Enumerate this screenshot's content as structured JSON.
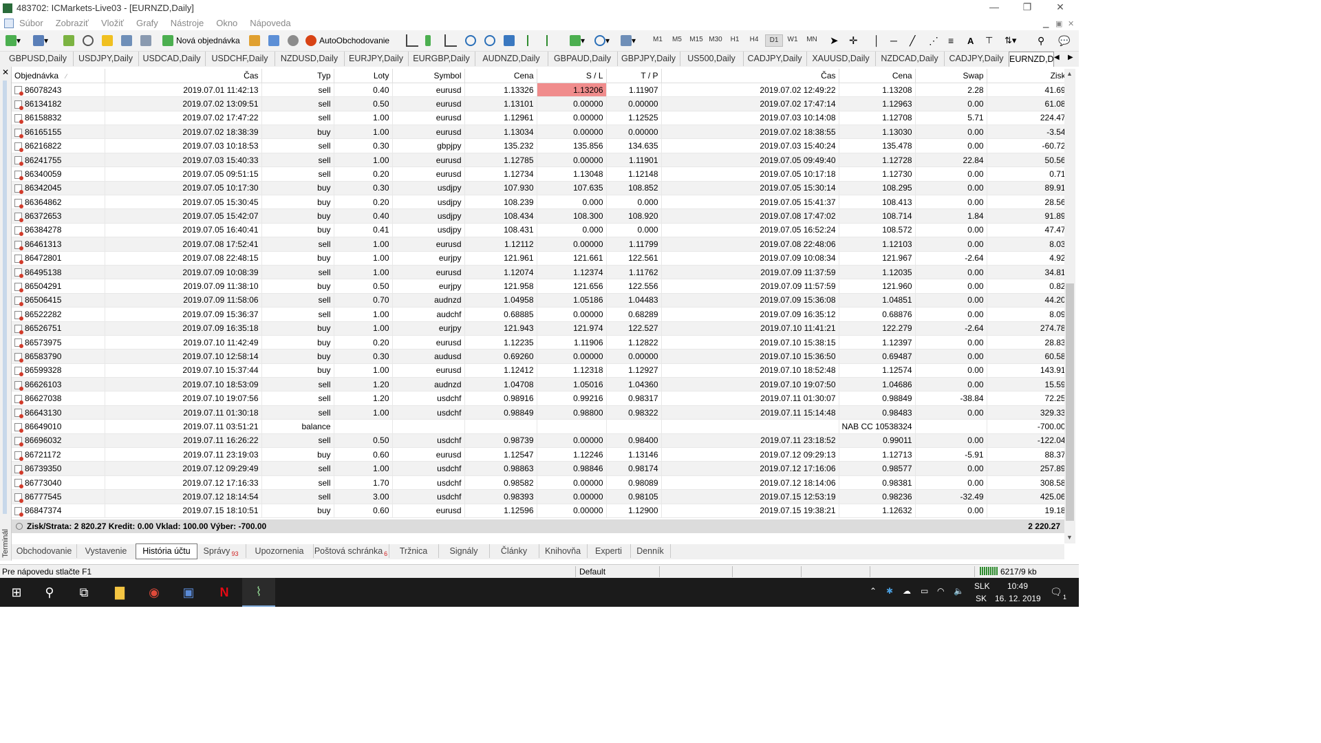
{
  "window": {
    "title": "483702: ICMarkets-Live03 - [EURNZD,Daily]",
    "min": "—",
    "max": "❐",
    "close": "✕"
  },
  "menu": {
    "items": [
      "Súbor",
      "Zobraziť",
      "Vložiť",
      "Grafy",
      "Nástroje",
      "Okno",
      "Nápoveda"
    ]
  },
  "toolbar": {
    "new_order": "Nová objednávka",
    "autotrading": "AutoObchodovanie",
    "timeframes": [
      "M1",
      "M5",
      "M15",
      "M30",
      "H1",
      "H4",
      "D1",
      "W1",
      "MN"
    ],
    "active_timeframe": "D1"
  },
  "chart_tabs": [
    "GBPUSD,Daily",
    "USDJPY,Daily",
    "USDCAD,Daily",
    "USDCHF,Daily",
    "NZDUSD,Daily",
    "EURJPY,Daily",
    "EURGBP,Daily",
    "AUDNZD,Daily",
    "GBPAUD,Daily",
    "GBPJPY,Daily",
    "US500,Daily",
    "CADJPY,Daily",
    "XAUUSD,Daily",
    "NZDCAD,Daily",
    "CADJPY,Daily",
    "EURNZD,Daily"
  ],
  "columns": [
    "Objednávka",
    "Čas",
    "Typ",
    "Loty",
    "Symbol",
    "Cena",
    "S / L",
    "T / P",
    "Čas",
    "Cena",
    "Swap",
    "Zisk"
  ],
  "rows": [
    [
      "86078243",
      "2019.07.01 11:42:13",
      "sell",
      "0.40",
      "eurusd",
      "1.13326",
      "1.13206",
      "1.11907",
      "2019.07.02 12:49:22",
      "1.13208",
      "2.28",
      "41.69"
    ],
    [
      "86134182",
      "2019.07.02 13:09:51",
      "sell",
      "0.50",
      "eurusd",
      "1.13101",
      "0.00000",
      "0.00000",
      "2019.07.02 17:47:14",
      "1.12963",
      "0.00",
      "61.08"
    ],
    [
      "86158832",
      "2019.07.02 17:47:22",
      "sell",
      "1.00",
      "eurusd",
      "1.12961",
      "0.00000",
      "1.12525",
      "2019.07.03 10:14:08",
      "1.12708",
      "5.71",
      "224.47"
    ],
    [
      "86165155",
      "2019.07.02 18:38:39",
      "buy",
      "1.00",
      "eurusd",
      "1.13034",
      "0.00000",
      "0.00000",
      "2019.07.02 18:38:55",
      "1.13030",
      "0.00",
      "-3.54"
    ],
    [
      "86216822",
      "2019.07.03 10:18:53",
      "sell",
      "0.30",
      "gbpjpy",
      "135.232",
      "135.856",
      "134.635",
      "2019.07.03 15:40:24",
      "135.478",
      "0.00",
      "-60.72"
    ],
    [
      "86241755",
      "2019.07.03 15:40:33",
      "sell",
      "1.00",
      "eurusd",
      "1.12785",
      "0.00000",
      "1.11901",
      "2019.07.05 09:49:40",
      "1.12728",
      "22.84",
      "50.56"
    ],
    [
      "86340059",
      "2019.07.05 09:51:15",
      "sell",
      "0.20",
      "eurusd",
      "1.12734",
      "1.13048",
      "1.12148",
      "2019.07.05 10:17:18",
      "1.12730",
      "0.00",
      "0.71"
    ],
    [
      "86342045",
      "2019.07.05 10:17:30",
      "buy",
      "0.30",
      "usdjpy",
      "107.930",
      "107.635",
      "108.852",
      "2019.07.05 15:30:14",
      "108.295",
      "0.00",
      "89.91"
    ],
    [
      "86364862",
      "2019.07.05 15:30:45",
      "buy",
      "0.20",
      "usdjpy",
      "108.239",
      "0.000",
      "0.000",
      "2019.07.05 15:41:37",
      "108.413",
      "0.00",
      "28.56"
    ],
    [
      "86372653",
      "2019.07.05 15:42:07",
      "buy",
      "0.40",
      "usdjpy",
      "108.434",
      "108.300",
      "108.920",
      "2019.07.08 17:47:02",
      "108.714",
      "1.84",
      "91.89"
    ],
    [
      "86384278",
      "2019.07.05 16:40:41",
      "buy",
      "0.41",
      "usdjpy",
      "108.431",
      "0.000",
      "0.000",
      "2019.07.05 16:52:24",
      "108.572",
      "0.00",
      "47.47"
    ],
    [
      "86461313",
      "2019.07.08 17:52:41",
      "sell",
      "1.00",
      "eurusd",
      "1.12112",
      "0.00000",
      "1.11799",
      "2019.07.08 22:48:06",
      "1.12103",
      "0.00",
      "8.03"
    ],
    [
      "86472801",
      "2019.07.08 22:48:15",
      "buy",
      "1.00",
      "eurjpy",
      "121.961",
      "121.661",
      "122.561",
      "2019.07.09 10:08:34",
      "121.967",
      "-2.64",
      "4.92"
    ],
    [
      "86495138",
      "2019.07.09 10:08:39",
      "sell",
      "1.00",
      "eurusd",
      "1.12074",
      "1.12374",
      "1.11762",
      "2019.07.09 11:37:59",
      "1.12035",
      "0.00",
      "34.81"
    ],
    [
      "86504291",
      "2019.07.09 11:38:10",
      "buy",
      "0.50",
      "eurjpy",
      "121.958",
      "121.656",
      "122.556",
      "2019.07.09 11:57:59",
      "121.960",
      "0.00",
      "0.82"
    ],
    [
      "86506415",
      "2019.07.09 11:58:06",
      "sell",
      "0.70",
      "audnzd",
      "1.04958",
      "1.05186",
      "1.04483",
      "2019.07.09 15:36:08",
      "1.04851",
      "0.00",
      "44.20"
    ],
    [
      "86522282",
      "2019.07.09 15:36:37",
      "sell",
      "1.00",
      "audchf",
      "0.68885",
      "0.00000",
      "0.68289",
      "2019.07.09 16:35:12",
      "0.68876",
      "0.00",
      "8.09"
    ],
    [
      "86526751",
      "2019.07.09 16:35:18",
      "buy",
      "1.00",
      "eurjpy",
      "121.943",
      "121.974",
      "122.527",
      "2019.07.10 11:41:21",
      "122.279",
      "-2.64",
      "274.78"
    ],
    [
      "86573975",
      "2019.07.10 11:42:49",
      "buy",
      "0.20",
      "eurusd",
      "1.12235",
      "1.11906",
      "1.12822",
      "2019.07.10 15:38:15",
      "1.12397",
      "0.00",
      "28.83"
    ],
    [
      "86583790",
      "2019.07.10 12:58:14",
      "buy",
      "0.30",
      "audusd",
      "0.69260",
      "0.00000",
      "0.00000",
      "2019.07.10 15:36:50",
      "0.69487",
      "0.00",
      "60.58"
    ],
    [
      "86599328",
      "2019.07.10 15:37:44",
      "buy",
      "1.00",
      "eurusd",
      "1.12412",
      "1.12318",
      "1.12927",
      "2019.07.10 18:52:48",
      "1.12574",
      "0.00",
      "143.91"
    ],
    [
      "86626103",
      "2019.07.10 18:53:09",
      "sell",
      "1.20",
      "audnzd",
      "1.04708",
      "1.05016",
      "1.04360",
      "2019.07.10 19:07:50",
      "1.04686",
      "0.00",
      "15.59"
    ],
    [
      "86627038",
      "2019.07.10 19:07:56",
      "sell",
      "1.20",
      "usdchf",
      "0.98916",
      "0.99216",
      "0.98317",
      "2019.07.11 01:30:07",
      "0.98849",
      "-38.84",
      "72.25"
    ],
    [
      "86643130",
      "2019.07.11 01:30:18",
      "sell",
      "1.00",
      "usdchf",
      "0.98849",
      "0.98800",
      "0.98322",
      "2019.07.11 15:14:48",
      "0.98483",
      "0.00",
      "329.33"
    ],
    [
      "86649010",
      "2019.07.11 03:51:21",
      "balance",
      "",
      "",
      "",
      "",
      "",
      "",
      "NAB CC 10538324",
      "",
      "-700.00"
    ],
    [
      "86696032",
      "2019.07.11 16:26:22",
      "sell",
      "0.50",
      "usdchf",
      "0.98739",
      "0.00000",
      "0.98400",
      "2019.07.11 23:18:52",
      "0.99011",
      "0.00",
      "-122.04"
    ],
    [
      "86721172",
      "2019.07.11 23:19:03",
      "buy",
      "0.60",
      "eurusd",
      "1.12547",
      "1.12246",
      "1.13146",
      "2019.07.12 09:29:13",
      "1.12713",
      "-5.91",
      "88.37"
    ],
    [
      "86739350",
      "2019.07.12 09:29:49",
      "sell",
      "1.00",
      "usdchf",
      "0.98863",
      "0.98846",
      "0.98174",
      "2019.07.12 17:16:06",
      "0.98577",
      "0.00",
      "257.89"
    ],
    [
      "86773040",
      "2019.07.12 17:16:33",
      "sell",
      "1.70",
      "usdchf",
      "0.98582",
      "0.00000",
      "0.98089",
      "2019.07.12 18:14:06",
      "0.98381",
      "0.00",
      "308.58"
    ],
    [
      "86777545",
      "2019.07.12 18:14:54",
      "sell",
      "3.00",
      "usdchf",
      "0.98393",
      "0.00000",
      "0.98105",
      "2019.07.15 12:53:19",
      "0.98236",
      "-32.49",
      "425.06"
    ],
    [
      "86847374",
      "2019.07.15 18:10:51",
      "buy",
      "0.60",
      "eurusd",
      "1.12596",
      "0.00000",
      "1.12900",
      "2019.07.15 19:38:21",
      "1.12632",
      "0.00",
      "19.18"
    ]
  ],
  "summary": {
    "text": "Zisk/Strata: 2 820.27  Kredit: 0.00  Vklad: 100.00  Výber: -700.00",
    "total": "2 220.27"
  },
  "terminal_label": "Terminál",
  "bottom_tabs": [
    {
      "label": "Obchodovanie",
      "badge": ""
    },
    {
      "label": "Vystavenie",
      "badge": ""
    },
    {
      "label": "História účtu",
      "badge": ""
    },
    {
      "label": "Správy",
      "badge": "93"
    },
    {
      "label": "Upozornenia",
      "badge": ""
    },
    {
      "label": "Poštová schránka",
      "badge": "6"
    },
    {
      "label": "Tržnica",
      "badge": ""
    },
    {
      "label": "Signály",
      "badge": ""
    },
    {
      "label": "Články",
      "badge": ""
    },
    {
      "label": "Knihovňa",
      "badge": ""
    },
    {
      "label": "Experti",
      "badge": ""
    },
    {
      "label": "Denník",
      "badge": ""
    }
  ],
  "active_bottom_tab": "História účtu",
  "status": {
    "help": "Pre nápovedu stlačte F1",
    "profile": "Default",
    "connection": "6217/9 kb"
  },
  "taskbar": {
    "lang_top": "SLK",
    "lang_bottom": "SK",
    "time": "10:49",
    "date": "16. 12. 2019",
    "notif": "1"
  }
}
